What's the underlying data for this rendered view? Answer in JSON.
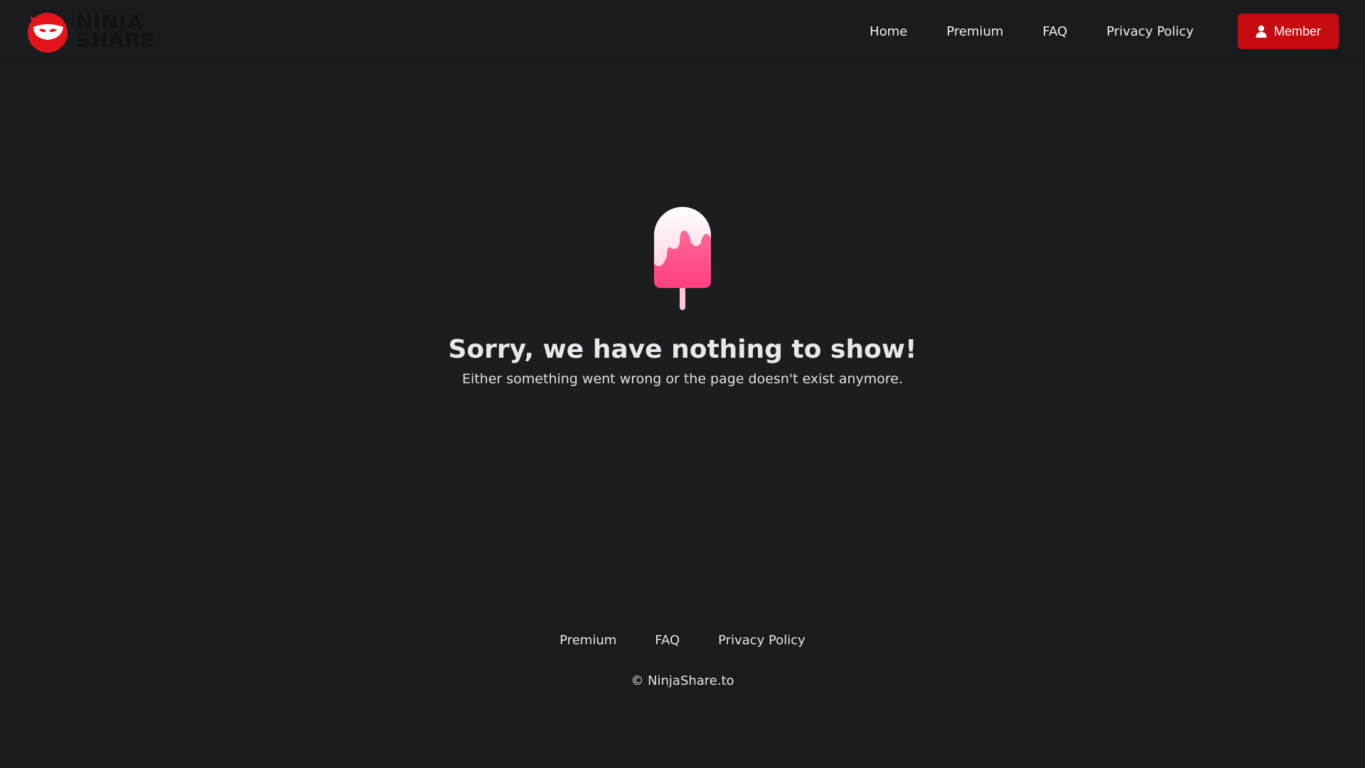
{
  "brand": {
    "name_line1": "NINJA",
    "name_line2": "SHARE",
    "accent_color": "#e3151b"
  },
  "header": {
    "nav": [
      {
        "label": "Home"
      },
      {
        "label": "Premium"
      },
      {
        "label": "FAQ"
      },
      {
        "label": "Privacy Policy"
      }
    ],
    "member_button": {
      "label": "Member",
      "icon": "user-icon",
      "color": "#c50b10"
    }
  },
  "empty_state": {
    "icon": "popsicle-icon",
    "title": "Sorry, we have nothing to show!",
    "subtitle": "Either something went wrong or the page doesn't exist anymore."
  },
  "footer": {
    "nav": [
      {
        "label": "Premium"
      },
      {
        "label": "FAQ"
      },
      {
        "label": "Privacy Policy"
      }
    ],
    "copyright": "© NinjaShare.to"
  }
}
